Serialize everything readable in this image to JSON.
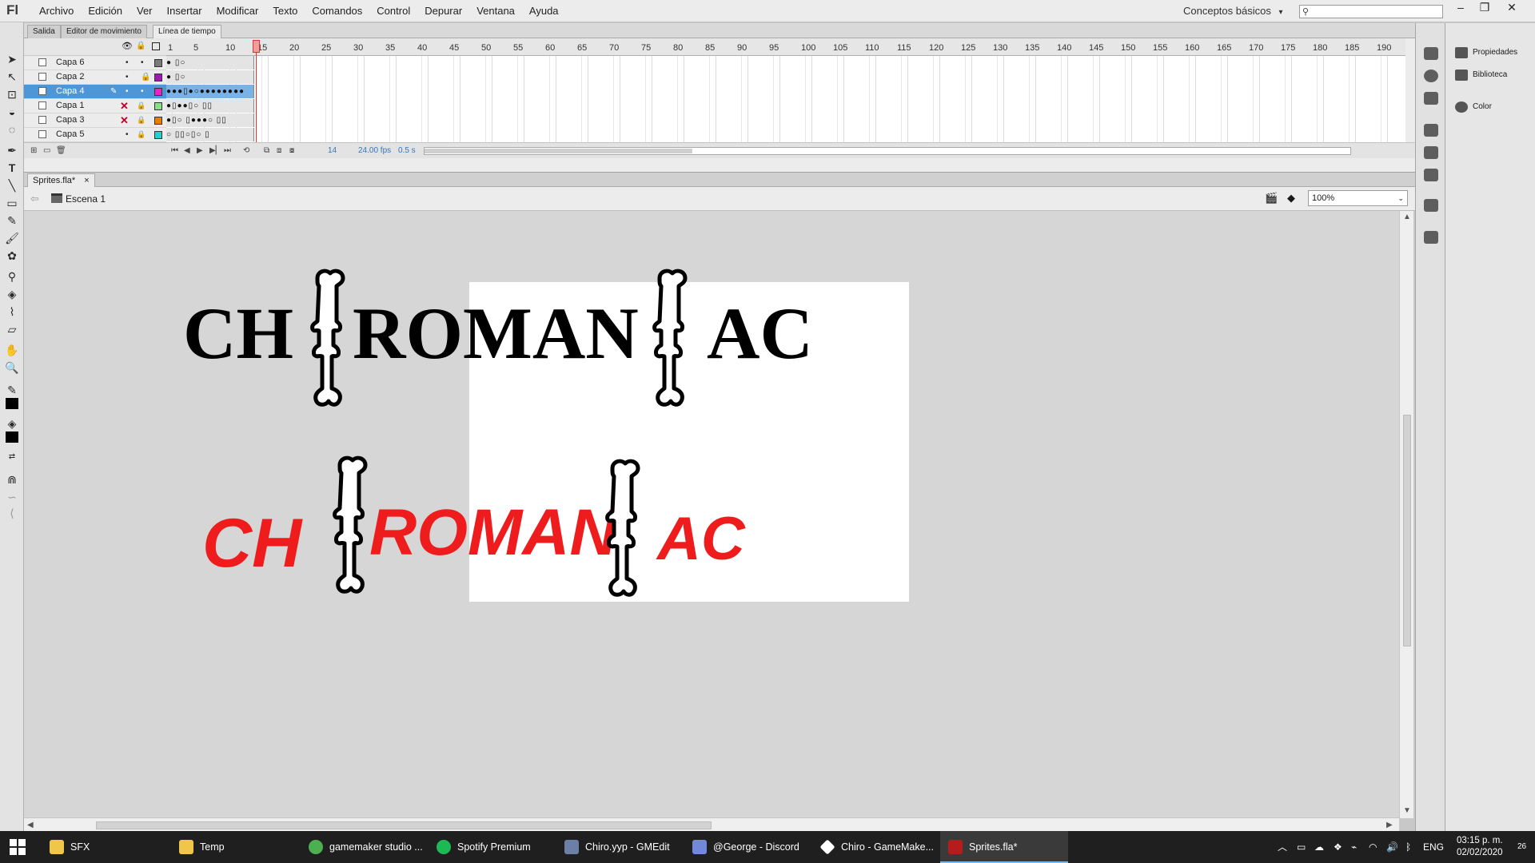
{
  "app": {
    "logo": "Fl",
    "menus": [
      "Archivo",
      "Edición",
      "Ver",
      "Insertar",
      "Modificar",
      "Texto",
      "Comandos",
      "Control",
      "Depurar",
      "Ventana",
      "Ayuda"
    ],
    "workspace": "Conceptos básicos",
    "workspace_arrow": "▾",
    "search_placeholder": "",
    "search_icon": "⚲",
    "window_controls": [
      "–",
      "❐",
      "✕"
    ]
  },
  "panel_tabs": [
    "Salida",
    "Editor de movimiento",
    "Línea de tiempo"
  ],
  "timeline": {
    "header_icons": [
      "eye-icon",
      "lock-icon",
      "outline-icon"
    ],
    "ruler": [
      "1",
      "5",
      "10",
      "15",
      "20",
      "25",
      "30",
      "35",
      "40",
      "45",
      "50",
      "55",
      "60",
      "65",
      "70",
      "75",
      "80",
      "85",
      "90",
      "95",
      "100",
      "105",
      "110",
      "115",
      "120",
      "125",
      "130",
      "135",
      "140",
      "145",
      "150",
      "155",
      "160",
      "165",
      "170",
      "175",
      "180",
      "185",
      "190"
    ],
    "layers": [
      {
        "name": "Capa 6",
        "hidden": false,
        "color": "#7a7a7a",
        "frames": "●  ▯○"
      },
      {
        "name": "Capa 2",
        "hidden": false,
        "color": "#a019b3",
        "frames": "●  ▯○"
      },
      {
        "name": "Capa 4",
        "hidden": false,
        "color": "#ea22c8",
        "frames": "●●●▯●○●●●●●●●●",
        "selected": true
      },
      {
        "name": "Capa 1",
        "hidden": true,
        "color": "#8ae08a",
        "frames": "●▯●●▯○     ▯▯"
      },
      {
        "name": "Capa 3",
        "hidden": true,
        "color": "#ee7a00",
        "frames": "●▯○ ▯●●●○ ▯▯"
      },
      {
        "name": "Capa 5",
        "hidden": false,
        "color": "#22d1d1",
        "frames": "○ ▯▯○▯○    ▯"
      }
    ],
    "footer": {
      "frame": "14",
      "fps": "24.00 fps",
      "time": "0.5 s"
    }
  },
  "document": {
    "tab": "Sprites.fla*",
    "tab_close": "×",
    "scene": "Escena 1",
    "zoom": "100%",
    "zoom_arrow": "⌄"
  },
  "stage": {
    "title_black": "CHIROMANIAC",
    "title_red": "CHIROMANIAC",
    "black_parts": [
      "CH",
      "ROMAN",
      "AC"
    ],
    "red_parts": [
      "CH",
      "ROMAN",
      "AC"
    ],
    "text_color_black": "#000000",
    "text_color_red": "#ee1c1c"
  },
  "right_panel": {
    "items": [
      "Propiedades",
      "Biblioteca",
      "Color"
    ]
  },
  "taskbar": {
    "tasks": [
      {
        "label": "SFX",
        "icon": "folder-icon",
        "color": "#f0c64a"
      },
      {
        "label": "Temp",
        "icon": "folder-icon",
        "color": "#f0c64a"
      },
      {
        "label": "gamemaker studio ...",
        "icon": "chrome-icon",
        "color": "#4caf50"
      },
      {
        "label": "Spotify Premium",
        "icon": "spotify-icon",
        "color": "#1db954"
      },
      {
        "label": "Chiro.yyp - GMEdit",
        "icon": "gmedit-icon",
        "color": "#6c7fa6"
      },
      {
        "label": "@George - Discord",
        "icon": "discord-icon",
        "color": "#7289da"
      },
      {
        "label": "Chiro - GameMake...",
        "icon": "gamemaker-icon",
        "color": "#ffffff"
      },
      {
        "label": "Sprites.fla*",
        "icon": "flash-icon",
        "color": "#b71c1c",
        "active": true
      }
    ],
    "tray": {
      "lang": "ENG",
      "time": "03:15 p. m.",
      "date": "02/02/2020",
      "notifications": "26"
    }
  }
}
